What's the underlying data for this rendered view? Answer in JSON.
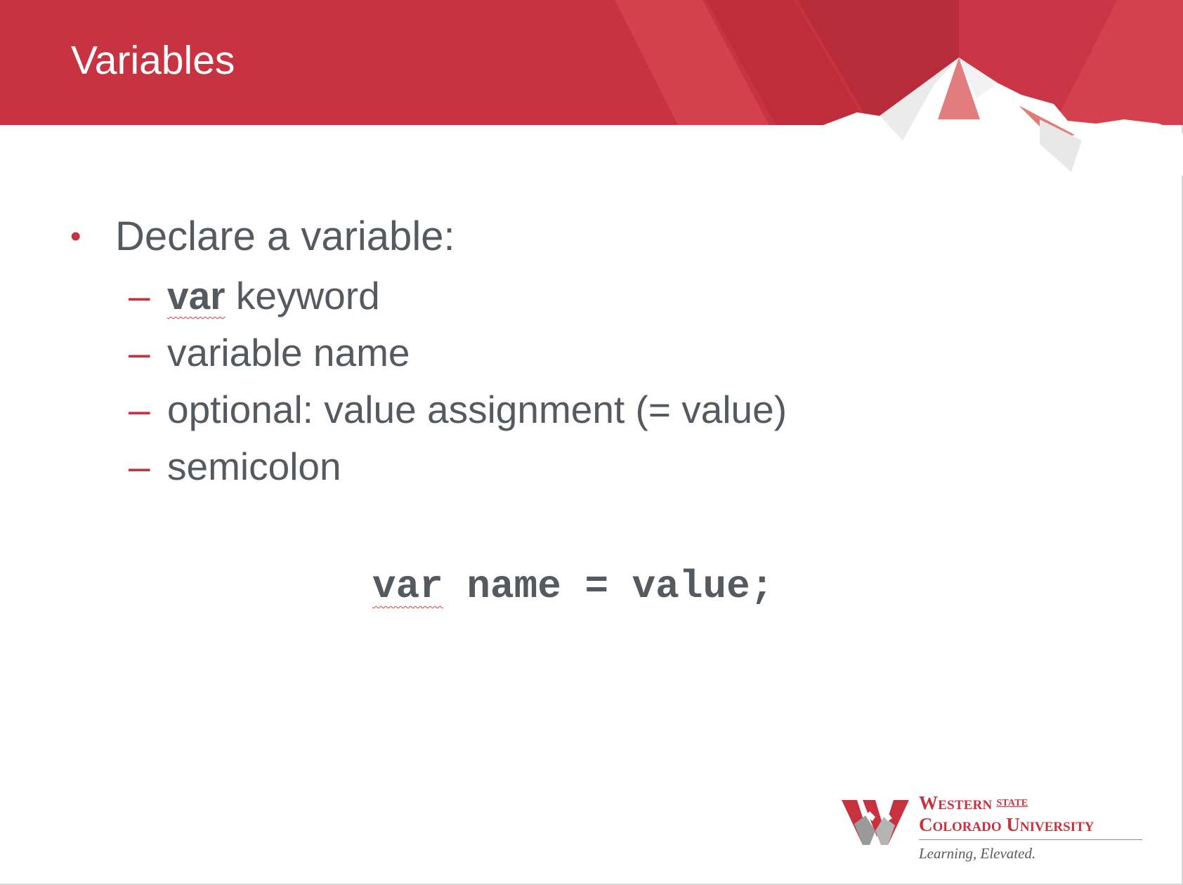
{
  "slide": {
    "title": "Variables",
    "bullet": "Declare a variable:",
    "sub_items": [
      {
        "keyword": "var",
        "text": " keyword"
      },
      {
        "keyword": "",
        "text": "variable name"
      },
      {
        "keyword": "",
        "text": "optional: value assignment (= value)"
      },
      {
        "keyword": "",
        "text": "semicolon"
      }
    ],
    "dash": "–",
    "bullet_dot": "•",
    "code": {
      "keyword": "var",
      "rest": " name = value;"
    }
  },
  "logo": {
    "name_line1": "Western",
    "state_label": "STATE",
    "name_line2": "Colorado University",
    "tagline": "Learning, Elevated."
  },
  "colors": {
    "brand_red": "#c8323f",
    "text_gray": "#555a5f"
  }
}
